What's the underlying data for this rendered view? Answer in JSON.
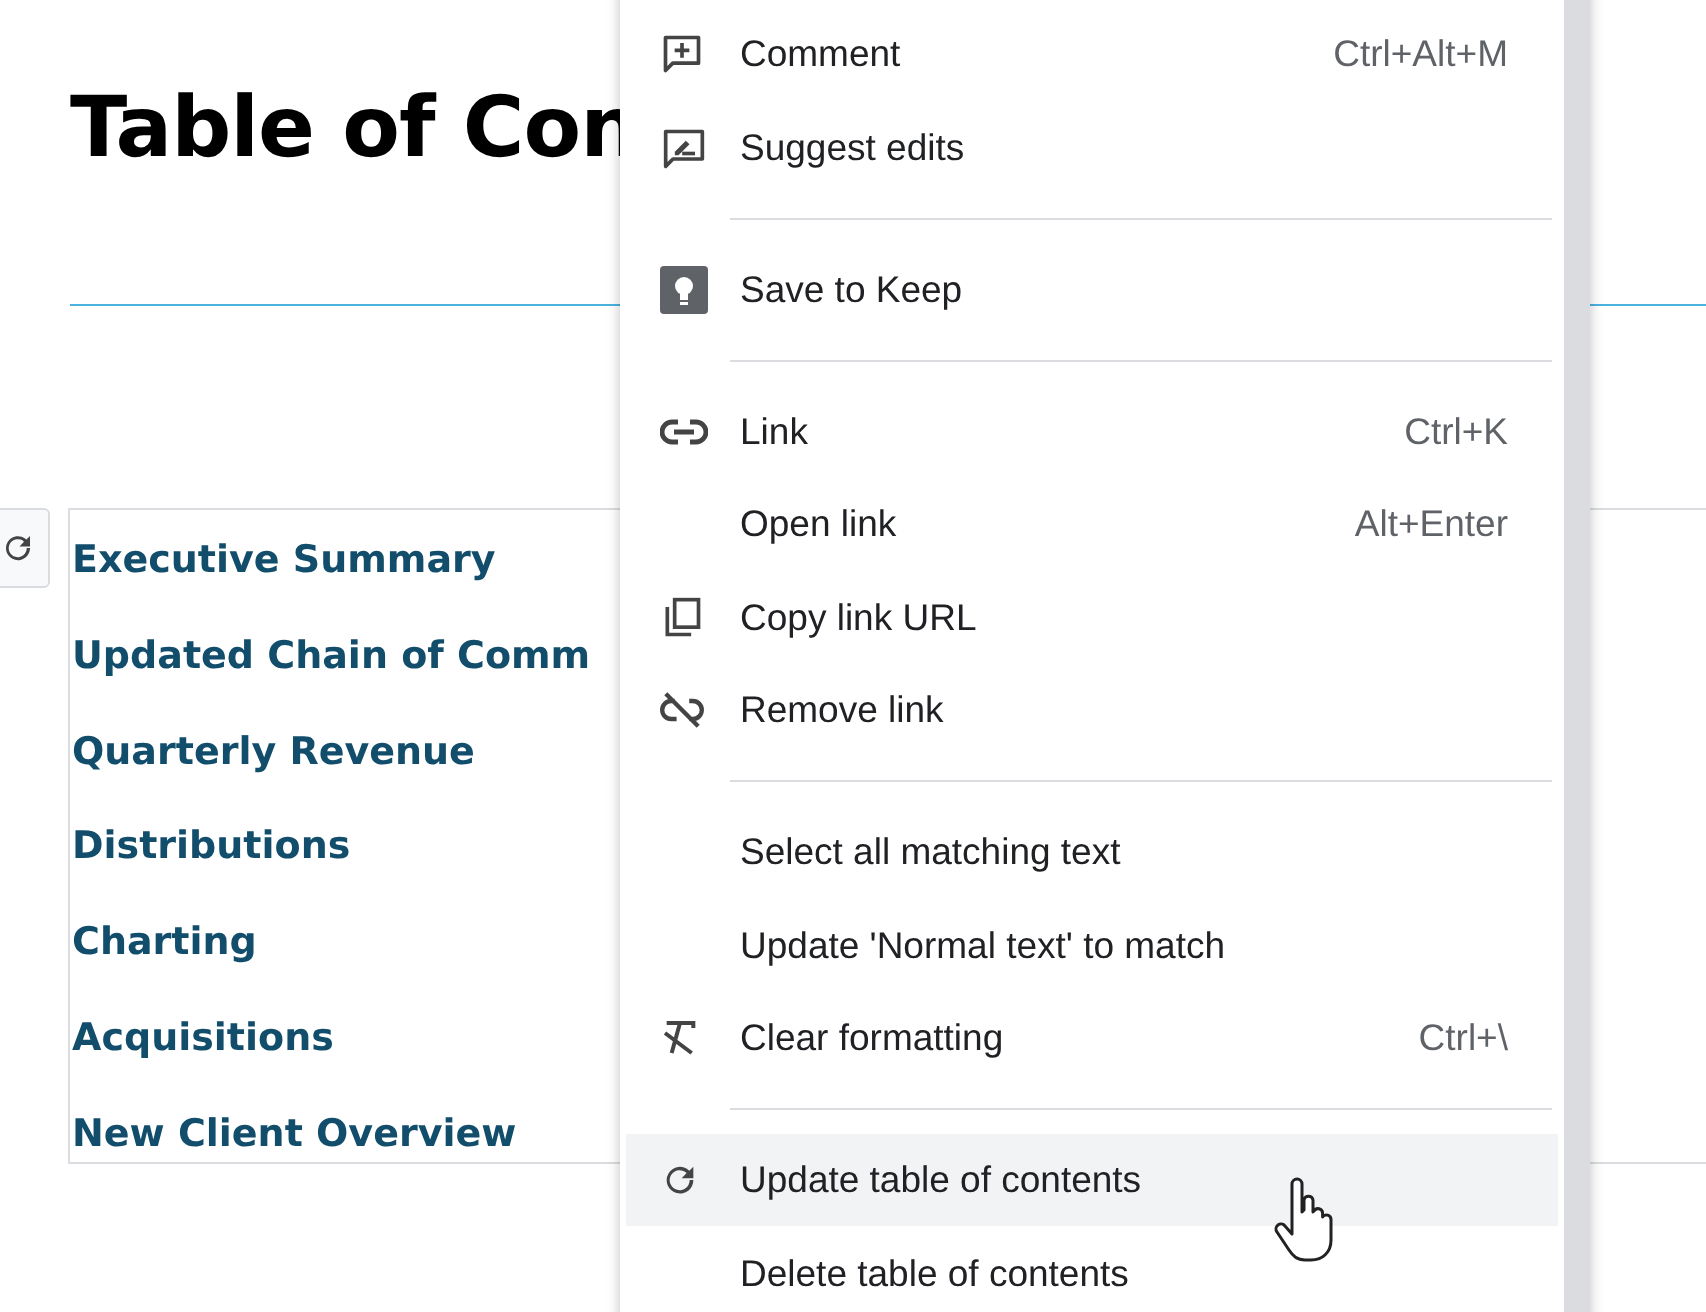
{
  "document": {
    "heading": "Table of Con",
    "toc_entries": [
      "Executive Summary",
      "Updated Chain of Comm",
      "Quarterly Revenue",
      "Distributions",
      "Charting",
      "Acquisitions",
      "New Client Overview"
    ]
  },
  "context_menu": {
    "items": [
      {
        "kind": "item",
        "label": "Comment",
        "shortcut": "Ctrl+Alt+M",
        "selected": false
      },
      {
        "kind": "item",
        "label": "Suggest edits",
        "selected": false
      },
      {
        "kind": "separator"
      },
      {
        "kind": "item",
        "label": "Save to Keep",
        "selected": false
      },
      {
        "kind": "separator"
      },
      {
        "kind": "item",
        "label": "Link",
        "shortcut": "Ctrl+K",
        "selected": false
      },
      {
        "kind": "item",
        "label": "Open link",
        "shortcut": "Alt+Enter",
        "selected": false
      },
      {
        "kind": "item",
        "label": "Copy link URL",
        "selected": false
      },
      {
        "kind": "item",
        "label": "Remove link",
        "selected": false
      },
      {
        "kind": "separator"
      },
      {
        "kind": "item",
        "label": "Select all matching text",
        "selected": false
      },
      {
        "kind": "item",
        "label": "Update 'Normal text' to match",
        "selected": false
      },
      {
        "kind": "item",
        "label": "Clear formatting",
        "shortcut": "Ctrl+\\",
        "selected": false
      },
      {
        "kind": "separator"
      },
      {
        "kind": "item",
        "label": "Update table of contents",
        "selected": true
      },
      {
        "kind": "item",
        "label": "Delete table of contents",
        "selected": false
      }
    ]
  }
}
